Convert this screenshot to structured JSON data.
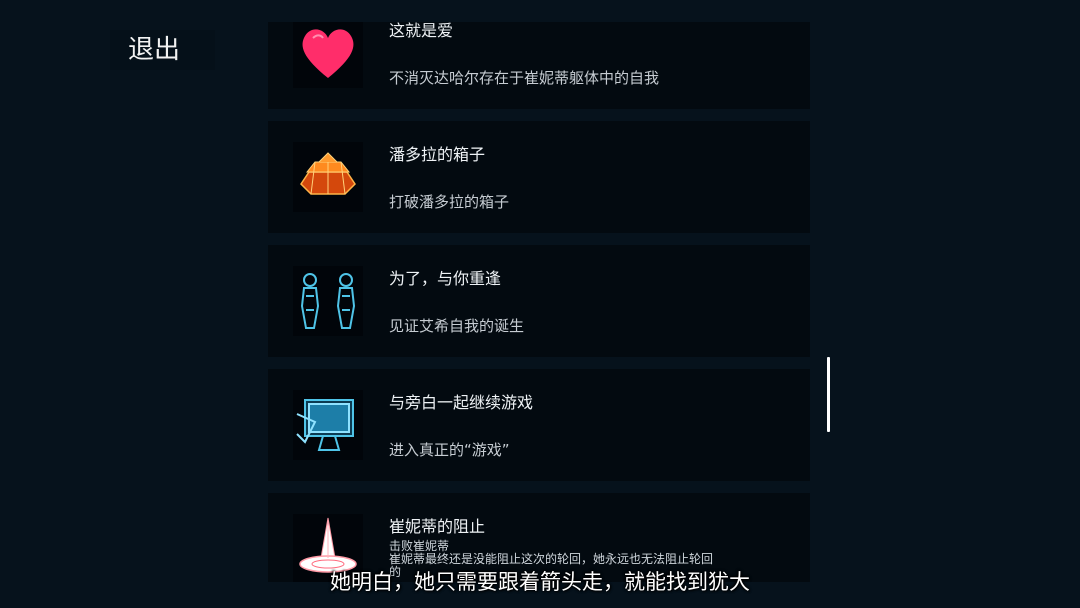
{
  "exit_label": "退出",
  "achievements": [
    {
      "title": "这就是爱",
      "desc": "不消灭达哈尔存在于崔妮蒂躯体中的自我",
      "icon": "heart-icon"
    },
    {
      "title": "潘多拉的箱子",
      "desc": "打破潘多拉的箱子",
      "icon": "pandora-box-icon"
    },
    {
      "title": "为了，与你重逢",
      "desc": "见证艾希自我的诞生",
      "icon": "two-figures-icon"
    },
    {
      "title": "与旁白一起继续游戏",
      "desc": "进入真正的“游戏”",
      "icon": "monitor-icon"
    },
    {
      "title": "崔妮蒂的阻止",
      "desc": "击败崔妮蒂",
      "icon": "spire-icon"
    }
  ],
  "overlay_line": "崔妮蒂最终还是没能阻止这次的轮回，她永远也无法阻止轮回",
  "overlay_fragment": "的",
  "subtitle": "她明白，她只需要跟着箭头走，就能找到犹大",
  "colors": {
    "background": "#06121c",
    "card": "#030a10",
    "heart": "#ff2d6a",
    "box": "#ff7a1a",
    "cyan": "#4fc4e8"
  }
}
